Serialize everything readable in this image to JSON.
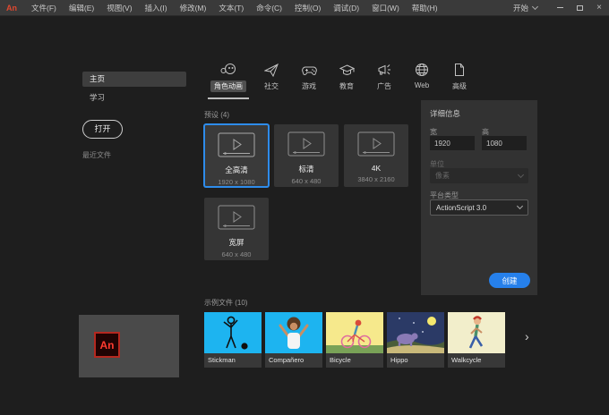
{
  "menubar": {
    "logo_text": "An",
    "items": [
      {
        "label": "文件(F)"
      },
      {
        "label": "编辑(E)"
      },
      {
        "label": "视图(V)"
      },
      {
        "label": "插入(I)"
      },
      {
        "label": "修改(M)"
      },
      {
        "label": "文本(T)"
      },
      {
        "label": "命令(C)"
      },
      {
        "label": "控制(O)"
      },
      {
        "label": "调试(D)"
      },
      {
        "label": "窗口(W)"
      },
      {
        "label": "帮助(H)"
      }
    ],
    "workspace_label": "开始",
    "window_controls": {
      "minimize": "minimize-icon",
      "maximize": "maximize-icon",
      "close": "×"
    }
  },
  "sidebar": {
    "items": [
      {
        "label": "主页",
        "active": true
      },
      {
        "label": "学习",
        "active": false
      }
    ],
    "open_button": "打开",
    "recent_label": "最近文件"
  },
  "tabs": [
    {
      "label": "角色动画",
      "icon": "character-face-icon",
      "active": true
    },
    {
      "label": "社交",
      "icon": "paper-plane-icon",
      "active": false
    },
    {
      "label": "游戏",
      "icon": "game-controller-icon",
      "active": false
    },
    {
      "label": "教育",
      "icon": "graduation-cap-icon",
      "active": false
    },
    {
      "label": "广告",
      "icon": "megaphone-icon",
      "active": false
    },
    {
      "label": "Web",
      "icon": "globe-icon",
      "active": false
    },
    {
      "label": "高级",
      "icon": "document-icon",
      "active": false
    }
  ],
  "presets": {
    "header": "预设 (4)",
    "cards": [
      {
        "name": "全高清",
        "dims": "1920 x 1080",
        "selected": true
      },
      {
        "name": "标清",
        "dims": "640 x 480",
        "selected": false
      },
      {
        "name": "4K",
        "dims": "3840 x 2160",
        "selected": false
      },
      {
        "name": "宽屏",
        "dims": "640 x 480",
        "selected": false
      }
    ]
  },
  "details": {
    "header": "详细信息",
    "width_label": "宽",
    "width_value": "1920",
    "height_label": "高",
    "height_value": "1080",
    "units_label": "单位",
    "units_value": "像素",
    "platform_label": "平台类型",
    "platform_value": "ActionScript 3.0",
    "create_button": "创建"
  },
  "samples": {
    "header": "示例文件 (10)",
    "cards": [
      {
        "name": "Stickman"
      },
      {
        "name": "Compañero"
      },
      {
        "name": "Bicycle"
      },
      {
        "name": "Hippo"
      },
      {
        "name": "Walkcycle"
      }
    ],
    "next_arrow": "›"
  },
  "colors": {
    "accent_blue": "#2680eb",
    "selected_border": "#2e8ceb",
    "menubar_bg": "#3a3a3a",
    "app_bg": "#1e1e1e",
    "panel_bg": "#323232",
    "card_bg": "#353535",
    "logo_red": "#e0482f",
    "sample_cyan": "#1db4f0",
    "sample_yellow": "#f6e98c",
    "sample_night": "#2b3a66",
    "sample_cream": "#f2eecb"
  }
}
